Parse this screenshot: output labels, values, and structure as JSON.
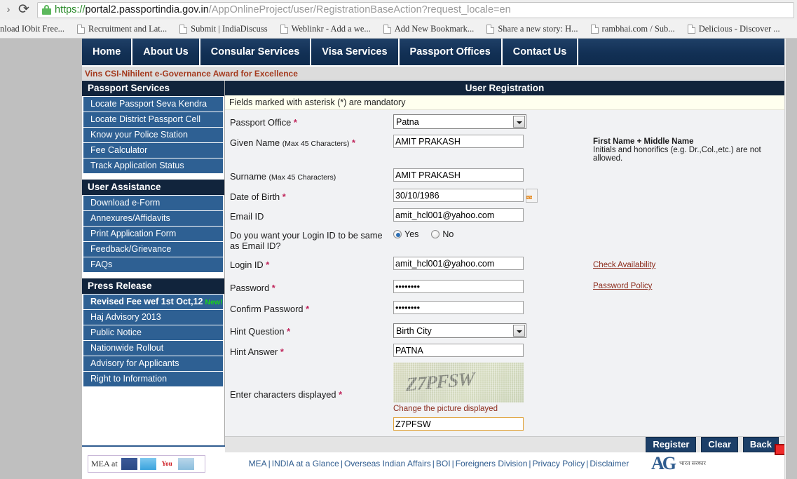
{
  "browser": {
    "url": {
      "scheme": "https://",
      "host": "portal2.passportindia.gov.in",
      "path": "/AppOnlineProject/user/RegistrationBaseAction?request_locale=en"
    },
    "reload_glyph": "⟳",
    "bookmarks": [
      "nload IObit Free...",
      "Recruitment and Lat...",
      "Submit | IndiaDiscuss",
      "Weblinkr - Add a we...",
      "Add New Bookmark...",
      "Share a new story: H...",
      "rambhai.com / Sub...",
      "Delicious - Discover ..."
    ]
  },
  "topnav": {
    "items": [
      "Home",
      "About Us",
      "Consular Services",
      "Visa Services",
      "Passport Offices",
      "Contact Us"
    ]
  },
  "marquee": {
    "text": "Vins CSI-Nihilent e-Governance Award for Excellence"
  },
  "sidebar": {
    "blocks": [
      {
        "title": "Passport Services",
        "items": [
          {
            "label": "Locate Passport Seva Kendra"
          },
          {
            "label": "Locate District Passport Cell"
          },
          {
            "label": "Know your Police Station"
          },
          {
            "label": "Fee Calculator"
          },
          {
            "label": "Track Application Status"
          }
        ]
      },
      {
        "title": "User Assistance",
        "items": [
          {
            "label": "Download e-Form"
          },
          {
            "label": "Annexures/Affidavits"
          },
          {
            "label": "Print Application Form"
          },
          {
            "label": "Feedback/Grievance"
          },
          {
            "label": "FAQs"
          }
        ]
      },
      {
        "title": "Press Release",
        "items": [
          {
            "label": "Revised Fee wef 1st Oct,12",
            "badge": "New!",
            "bold": true
          },
          {
            "label": "Haj Advisory 2013"
          },
          {
            "label": "Public Notice"
          },
          {
            "label": "Nationwide Rollout"
          },
          {
            "label": "Advisory for Applicants"
          },
          {
            "label": "Right to Information"
          }
        ]
      }
    ]
  },
  "main": {
    "title": "User Registration",
    "mandatory_note": "Fields marked with asterisk (*) are mandatory",
    "fields": {
      "passport_office": {
        "label": "Passport Office",
        "required": true,
        "value": "Patna",
        "options": [
          "Patna"
        ]
      },
      "given_name": {
        "label": "Given Name",
        "sublabel": "(Max 45 Characters)",
        "required": true,
        "value": "AMIT PRAKASH",
        "hint_title": "First Name + Middle Name",
        "hint_text": "Initials and honorifics (e.g. Dr.,Col.,etc.) are not allowed."
      },
      "surname": {
        "label": "Surname",
        "sublabel": "(Max 45 Characters)",
        "required": false,
        "value": "AMIT PRAKASH"
      },
      "date_of_birth": {
        "label": "Date of Birth",
        "required": true,
        "value": "30/10/1986",
        "calendar_day": "17",
        "calendar_month": "NOV"
      },
      "email_id": {
        "label": "Email ID",
        "required": false,
        "value": "amit_hcl001@yahoo.com"
      },
      "login_same_as_email": {
        "label": "Do you want your Login ID to be same as Email ID?",
        "options": [
          "Yes",
          "No"
        ],
        "selected": "Yes"
      },
      "login_id": {
        "label": "Login ID",
        "required": true,
        "value": "amit_hcl001@yahoo.com",
        "side_link": "Check Availability"
      },
      "password": {
        "label": "Password",
        "required": true,
        "value": "••••••••",
        "side_link": "Password Policy"
      },
      "confirm_password": {
        "label": "Confirm Password",
        "required": true,
        "value": "••••••••"
      },
      "hint_question": {
        "label": "Hint Question",
        "required": true,
        "value": "Birth City",
        "options": [
          "Birth City"
        ]
      },
      "hint_answer": {
        "label": "Hint Answer",
        "required": true,
        "value": "PATNA"
      },
      "captcha": {
        "label": "Enter characters displayed",
        "required": true,
        "image_text": "Z7PFSW",
        "change_link": "Change the picture displayed",
        "value": "Z7PFSW"
      }
    },
    "buttons": {
      "register": "Register",
      "clear": "Clear",
      "back": "Back"
    }
  },
  "footer": {
    "social_label": "MEA at",
    "social_icons": [
      "facebook-icon",
      "twitter-icon",
      "youtube-icon",
      "rss-icon"
    ],
    "youtube_text": "You",
    "links": [
      "MEA",
      "INDIA at a Glance",
      "Overseas Indian Affairs",
      "BOI",
      "Foreigners Division",
      "Privacy Policy",
      "Disclaimer"
    ],
    "separator": "|",
    "logo_text": "AG",
    "logo_caption": "भारत सरकार"
  },
  "colors": {
    "nav_dark": "#11243c",
    "nav_blue": "#2e6093",
    "accent_red": "#a43a1e",
    "link_red": "#8c2b1b",
    "required_pink": "#c0275c",
    "arrow_red": "#e8232a"
  }
}
